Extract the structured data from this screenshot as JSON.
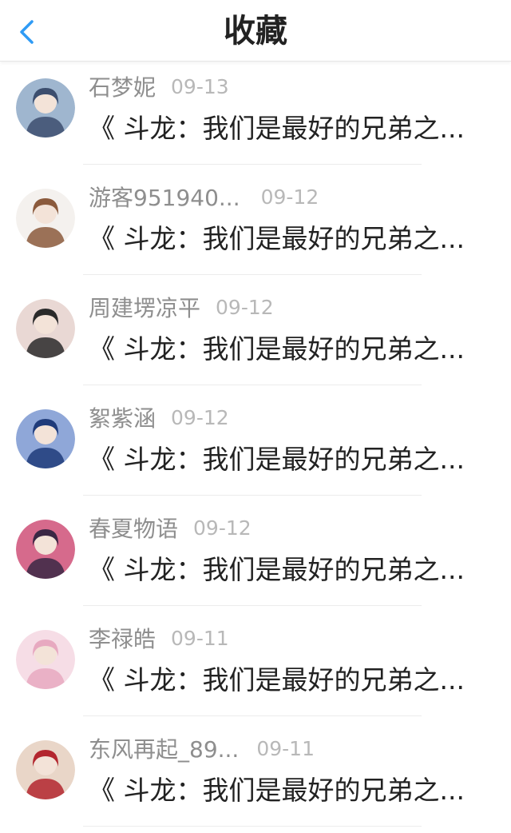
{
  "header": {
    "title": "收藏",
    "back_icon": "chevron-left-icon",
    "accent": "#2f9bf5"
  },
  "items": [
    {
      "user": "石梦妮",
      "date": "09-13",
      "title": "《 斗龙：我们是最好的兄弟之...",
      "avatar_colors": [
        "#9fb6cf",
        "#3c4e6e"
      ]
    },
    {
      "user": "游客951940...",
      "date": "09-12",
      "title": "《 斗龙：我们是最好的兄弟之...",
      "avatar_colors": [
        "#f4f1ee",
        "#8b5a3c"
      ]
    },
    {
      "user": "周建塄凉平",
      "date": "09-12",
      "title": "《 斗龙：我们是最好的兄弟之...",
      "avatar_colors": [
        "#e9d8d4",
        "#2a2a2a"
      ]
    },
    {
      "user": "絮紫涵",
      "date": "09-12",
      "title": "《 斗龙：我们是最好的兄弟之...",
      "avatar_colors": [
        "#8fa7d8",
        "#1f3b7a"
      ]
    },
    {
      "user": "春夏物语",
      "date": "09-12",
      "title": "《 斗龙：我们是最好的兄弟之...",
      "avatar_colors": [
        "#d66a8c",
        "#3a2744"
      ]
    },
    {
      "user": "李禄皓",
      "date": "09-11",
      "title": "《 斗龙：我们是最好的兄弟之...",
      "avatar_colors": [
        "#f6dde6",
        "#e7a9c0"
      ]
    },
    {
      "user": "东风再起_89...",
      "date": "09-11",
      "title": "《 斗龙：我们是最好的兄弟之...",
      "avatar_colors": [
        "#e9d6c8",
        "#b3262e"
      ]
    }
  ]
}
